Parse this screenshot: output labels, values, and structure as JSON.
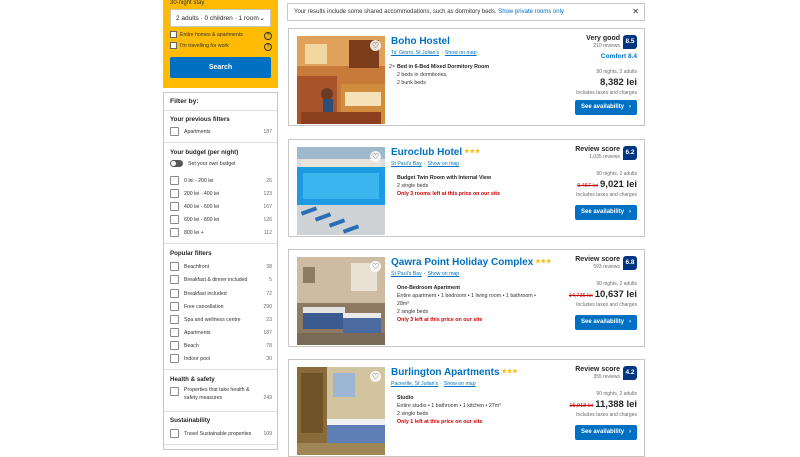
{
  "search": {
    "label": "30-night stay",
    "guests": "2 adults · 0 children · 1 room",
    "options": [
      {
        "label": "Entire homes & apartments",
        "help": "?"
      },
      {
        "label": "I'm travelling for work",
        "help": "?"
      }
    ],
    "button": "Search"
  },
  "filters": {
    "heading": "Filter by:",
    "previous": {
      "title": "Your previous filters",
      "items": [
        {
          "label": "Apartments",
          "count": "187"
        }
      ]
    },
    "budget": {
      "title": "Your budget (per night)",
      "toggle_label": "Set your own budget",
      "items": [
        {
          "label": "0 lei - 200 lei",
          "count": "26"
        },
        {
          "label": "200 lei - 400 lei",
          "count": "123"
        },
        {
          "label": "400 lei - 600 lei",
          "count": "167"
        },
        {
          "label": "600 lei - 800 lei",
          "count": "126"
        },
        {
          "label": "800 lei +",
          "count": "112"
        }
      ]
    },
    "popular": {
      "title": "Popular filters",
      "items": [
        {
          "label": "Beachfront",
          "count": "38"
        },
        {
          "label": "Breakfast & dinner included",
          "count": "5"
        },
        {
          "label": "Breakfast included",
          "count": "72"
        },
        {
          "label": "Free cancellation",
          "count": "290"
        },
        {
          "label": "Spa and wellness centre",
          "count": "23"
        },
        {
          "label": "Apartments",
          "count": "187"
        },
        {
          "label": "Beach",
          "count": "78"
        },
        {
          "label": "Indoor pool",
          "count": "30"
        }
      ]
    },
    "health": {
      "title": "Health & safety",
      "items": [
        {
          "label": "Properties that take health & safety measures",
          "count": "249"
        }
      ]
    },
    "sustainability": {
      "title": "Sustainability",
      "items": [
        {
          "label": "Travel Sustainable properties",
          "count": "109"
        }
      ]
    }
  },
  "notice": {
    "text": "Your results include some shared accommodations, such as dormitory beds.",
    "link": "Show private rooms only",
    "close": "✕"
  },
  "results": [
    {
      "name": "Boho Hostel",
      "stars": "",
      "area": "Ta' Giorni, St Julian's",
      "map": "Show on map",
      "multiplier": "2×",
      "room_title": "Bed in 6-Bed Mixed Dormitory Room",
      "room_lines": [
        "2 beds in dormitories,",
        "2 bunk beds"
      ],
      "alert": "",
      "score_label": "Very good",
      "reviews": "210 reviews",
      "score": "8.5",
      "comfort": "Comfort 8.4",
      "nights": "90 nights, 2 adults",
      "old_price": "",
      "price": "8,382 lei",
      "taxes": "Includes taxes and charges",
      "button": "See availability",
      "arrow": "›"
    },
    {
      "name": "Euroclub Hotel",
      "stars": "★★★",
      "area": "St Paul's Bay",
      "map": "Show on map",
      "multiplier": "",
      "room_title": "Budget Twin Room with Internal View",
      "room_lines": [
        "2 single beds"
      ],
      "alert": "Only 3 rooms left at this price on our site",
      "score_label": "Review score",
      "reviews": "1,035 reviews",
      "score": "6.2",
      "comfort": "",
      "nights": "90 nights, 2 adults",
      "old_price": "9,457 lei",
      "price": "9,021 lei",
      "taxes": "Includes taxes and charges",
      "button": "See availability",
      "arrow": "›"
    },
    {
      "name": "Qawra Point Holiday Complex",
      "stars": "★★★",
      "area": "St Paul's Bay",
      "map": "Show on map",
      "multiplier": "",
      "room_title": "One-Bedroom Apartment",
      "room_lines": [
        "Entire apartment • 1 bedroom • 1 living room • 1 bathroom • 28m²",
        "2 single beds"
      ],
      "alert": "Only 3 left at this price on our site",
      "score_label": "Review score",
      "reviews": "593 reviews",
      "score": "6.8",
      "comfort": "",
      "nights": "90 nights, 2 adults",
      "old_price": "14,736 lei",
      "price": "10,637 lei",
      "taxes": "Includes taxes and charges",
      "button": "See availability",
      "arrow": "›"
    },
    {
      "name": "Burlington Apartments",
      "stars": "★★★",
      "area": "Paceville, St Julian's",
      "map": "Show on map",
      "multiplier": "",
      "room_title": "Studio",
      "room_lines": [
        "Entire studio • 1 bathroom • 1 kitchen • 27m²",
        "2 single beds"
      ],
      "alert": "Only 1 left at this price on our site",
      "score_label": "Review score",
      "reviews": "355 reviews",
      "score": "4.2",
      "comfort": "",
      "nights": "90 nights, 2 adults",
      "old_price": "15,918 lei",
      "price": "11,388 lei",
      "taxes": "Includes taxes and charges",
      "button": "See availability",
      "arrow": "›"
    }
  ],
  "colors": {
    "brand_blue": "#0071c2",
    "dark_blue": "#003580",
    "yellow": "#febb02",
    "red": "#cc0000"
  }
}
